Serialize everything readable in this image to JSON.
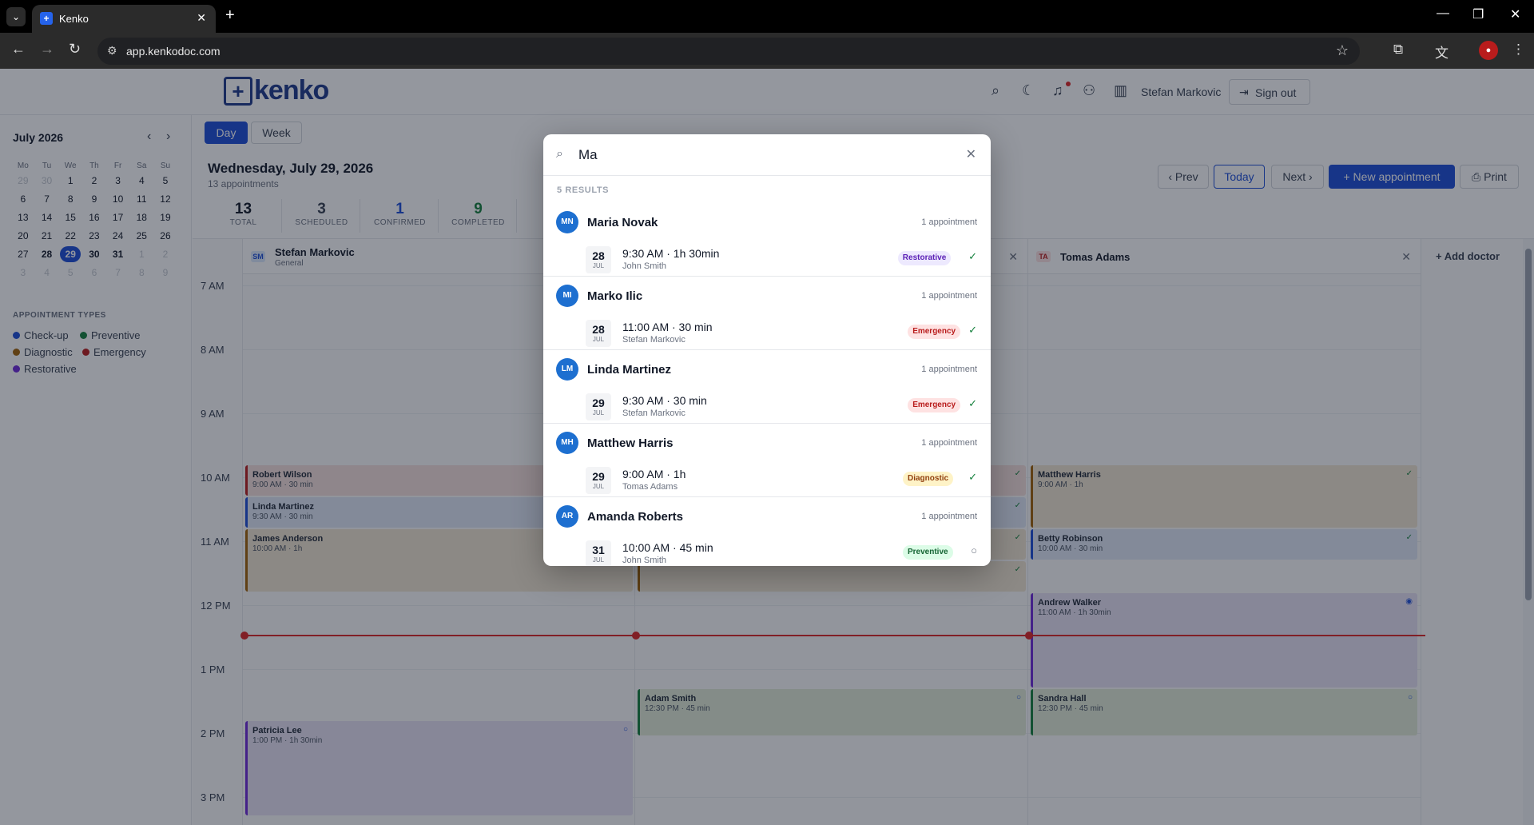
{
  "browser": {
    "tab_title": "Kenko",
    "url": "app.kenkodoc.com"
  },
  "header": {
    "brand": "kenko",
    "user": "Stefan Markovic",
    "signout": "Sign out"
  },
  "sidebar": {
    "month_title": "July 2026",
    "weekdays": [
      "Mo",
      "Tu",
      "We",
      "Th",
      "Fr",
      "Sa",
      "Su"
    ],
    "days": [
      [
        "29",
        "30",
        "1",
        "2",
        "3",
        "4",
        "5"
      ],
      [
        "6",
        "7",
        "8",
        "9",
        "10",
        "11",
        "12"
      ],
      [
        "13",
        "14",
        "15",
        "16",
        "17",
        "18",
        "19"
      ],
      [
        "20",
        "21",
        "22",
        "23",
        "24",
        "25",
        "26"
      ],
      [
        "27",
        "28",
        "29",
        "30",
        "31",
        "1",
        "2"
      ],
      [
        "3",
        "4",
        "5",
        "6",
        "7",
        "8",
        "9"
      ]
    ],
    "legend_title": "APPOINTMENT TYPES",
    "legend": [
      {
        "label": "Check-up",
        "color": "#1d4ed8"
      },
      {
        "label": "Preventive",
        "color": "#15803d"
      },
      {
        "label": "Diagnostic",
        "color": "#a16207"
      },
      {
        "label": "Emergency",
        "color": "#b91c1c"
      },
      {
        "label": "Restorative",
        "color": "#6d28d9"
      }
    ]
  },
  "main": {
    "view_day": "Day",
    "view_week": "Week",
    "date_title": "Wednesday, July 29, 2026",
    "date_sub": "13 appointments",
    "prev": "‹ Prev",
    "today": "Today",
    "next": "Next ›",
    "new_appt": "+  New appointment",
    "print": "Print",
    "stats": [
      {
        "num": "13",
        "label": "TOTAL",
        "color": "#111827"
      },
      {
        "num": "3",
        "label": "SCHEDULED",
        "color": "#374151"
      },
      {
        "num": "1",
        "label": "CONFIRMED",
        "color": "#1d4ed8"
      },
      {
        "num": "9",
        "label": "COMPLETED",
        "color": "#15803d"
      }
    ],
    "time_labels": [
      "7 AM",
      "8 AM",
      "9 AM",
      "10 AM",
      "11 AM",
      "12 PM",
      "1 PM",
      "2 PM",
      "3 PM"
    ],
    "add_doctor": "+  Add doctor",
    "doctors": [
      {
        "initials": "SM",
        "name": "Stefan Markovic",
        "spec": "General"
      },
      {
        "initials": "",
        "name": "",
        "spec": ""
      },
      {
        "initials": "TA",
        "name": "Tomas Adams",
        "spec": ""
      }
    ],
    "appointments": [
      {
        "name": "Robert Wilson",
        "time": "9:00 AM · 30 min"
      },
      {
        "name": "Linda Martinez",
        "time": "9:30 AM · 30 min"
      },
      {
        "name": "James Anderson",
        "time": "10:00 AM · 1h"
      },
      {
        "name": "Patricia Lee",
        "time": "1:00 PM · 1h 30min"
      },
      {
        "name": "Adam Smith",
        "time": "12:30 PM · 45 min"
      },
      {
        "name": "Matthew Harris",
        "time": "9:00 AM · 1h"
      },
      {
        "name": "Betty Robinson",
        "time": "10:00 AM · 30 min"
      },
      {
        "name": "Andrew Walker",
        "time": "11:00 AM · 1h 30min"
      },
      {
        "name": "Sandra Hall",
        "time": "12:30 PM · 45 min"
      }
    ]
  },
  "search": {
    "query": "Ma",
    "count": "5 RESULTS",
    "results": [
      {
        "initials": "MN",
        "name": "Maria Novak",
        "count": "1 appointment",
        "day": "28",
        "month": "JUL",
        "time": "9:30 AM · 1h 30min",
        "doctor": "John Smith",
        "tag": "Restorative",
        "status": "✓"
      },
      {
        "initials": "MI",
        "name": "Marko Ilic",
        "count": "1 appointment",
        "day": "28",
        "month": "JUL",
        "time": "11:00 AM · 30 min",
        "doctor": "Stefan Markovic",
        "tag": "Emergency",
        "status": "✓"
      },
      {
        "initials": "LM",
        "name": "Linda Martinez",
        "count": "1 appointment",
        "day": "29",
        "month": "JUL",
        "time": "9:30 AM · 30 min",
        "doctor": "Stefan Markovic",
        "tag": "Emergency",
        "status": "✓"
      },
      {
        "initials": "MH",
        "name": "Matthew Harris",
        "count": "1 appointment",
        "day": "29",
        "month": "JUL",
        "time": "9:00 AM · 1h",
        "doctor": "Tomas Adams",
        "tag": "Diagnostic",
        "status": "✓"
      },
      {
        "initials": "AR",
        "name": "Amanda Roberts",
        "count": "1 appointment",
        "day": "31",
        "month": "JUL",
        "time": "10:00 AM · 45 min",
        "doctor": "John Smith",
        "tag": "Preventive",
        "status": "○"
      }
    ]
  }
}
